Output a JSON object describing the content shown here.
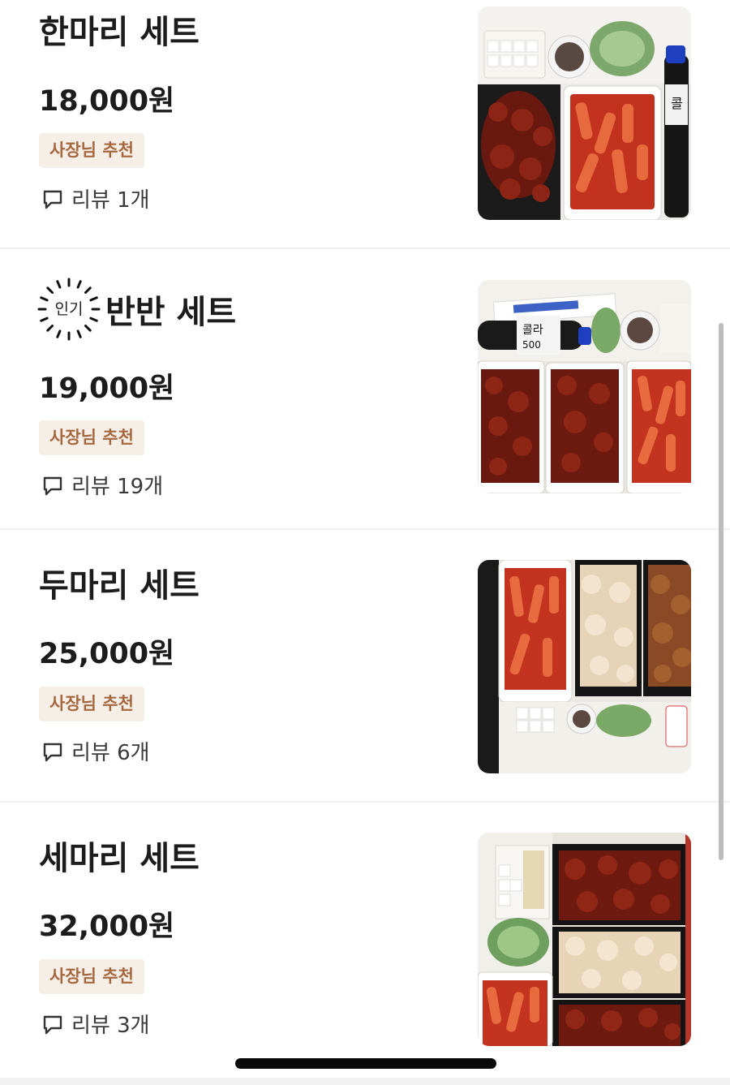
{
  "menu": {
    "items": [
      {
        "name": "한마리 세트",
        "price": "18,000원",
        "badge": "사장님 추천",
        "review_label": "리뷰 1개",
        "popular": false,
        "image": "chicken-tteokbokki-set-photo"
      },
      {
        "name": "반반 세트",
        "price": "19,000원",
        "badge": "사장님 추천",
        "review_label": "리뷰 19개",
        "popular": true,
        "popular_label": "인기",
        "image": "half-half-chicken-set-photo"
      },
      {
        "name": "두마리 세트",
        "price": "25,000원",
        "badge": "사장님 추천",
        "review_label": "리뷰 6개",
        "popular": false,
        "image": "two-chicken-set-photo"
      },
      {
        "name": "세마리 세트",
        "price": "32,000원",
        "badge": "사장님 추천",
        "review_label": "리뷰 3개",
        "popular": false,
        "image": "three-chicken-set-photo"
      }
    ]
  },
  "colors": {
    "badge_bg": "#f6efe8",
    "badge_text": "#a7683f",
    "sauce_chicken": "#7a1c12",
    "tteokbokki": "#c8361f",
    "fried_chicken": "#e8d2b5"
  }
}
